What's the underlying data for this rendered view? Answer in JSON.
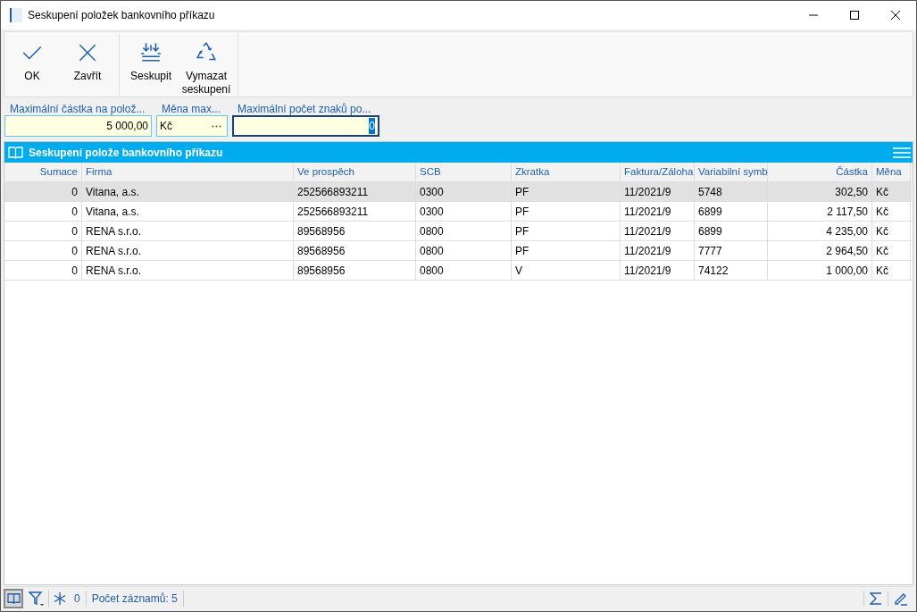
{
  "window": {
    "title": "Seskupení položek bankovního příkazu"
  },
  "toolbar": [
    {
      "kind": "check",
      "label": "OK"
    },
    {
      "kind": "close",
      "label": "Zavřít"
    },
    {
      "kind": "group",
      "label": "Seskupit"
    },
    {
      "kind": "recycle",
      "label": "Vymazat seskupení"
    }
  ],
  "fields": [
    {
      "label": "Maximální částka na polož...",
      "value": "5 000,00",
      "kind": "number",
      "focused": false
    },
    {
      "label": "Měna max...",
      "value": "Kč",
      "kind": "lookup",
      "focused": false
    },
    {
      "label": "Maximální počet znaků po...",
      "value": "0",
      "kind": "number",
      "focused": true
    }
  ],
  "grid": {
    "title": "Seskupení polože bankovního příkazu",
    "columns": [
      {
        "label": "Sumace"
      },
      {
        "label": "Firma"
      },
      {
        "label": "Ve prospěch"
      },
      {
        "label": "SCB"
      },
      {
        "label": "Zkratka"
      },
      {
        "label": "Faktura/Záloha"
      },
      {
        "label": "Variabilní symb"
      },
      {
        "label": "Částka"
      },
      {
        "label": "Měna"
      }
    ],
    "rows": [
      {
        "selected": true,
        "cells": [
          "0",
          "Vitana, a.s.",
          "252566893211",
          "0300",
          "PF",
          "11/2021/9",
          "5748",
          "302,50",
          "Kč"
        ]
      },
      {
        "selected": false,
        "cells": [
          "0",
          "Vitana, a.s.",
          "252566893211",
          "0300",
          "PF",
          "11/2021/9",
          "6899",
          "2 117,50",
          "Kč"
        ]
      },
      {
        "selected": false,
        "cells": [
          "0",
          "RENA s.r.o.",
          "89568956",
          "0800",
          "PF",
          "11/2021/9",
          "6899",
          "4 235,00",
          "Kč"
        ]
      },
      {
        "selected": false,
        "cells": [
          "0",
          "RENA s.r.o.",
          "89568956",
          "0800",
          "PF",
          "11/2021/9",
          "7777",
          "2 964,50",
          "Kč"
        ]
      },
      {
        "selected": false,
        "cells": [
          "0",
          "RENA s.r.o.",
          "89568956",
          "0800",
          "V",
          "11/2021/9",
          "74122",
          "1 000,00",
          "Kč"
        ]
      }
    ]
  },
  "status_bar": {
    "freeze_count": "0",
    "record_count": "Počet záznamů: 5"
  }
}
